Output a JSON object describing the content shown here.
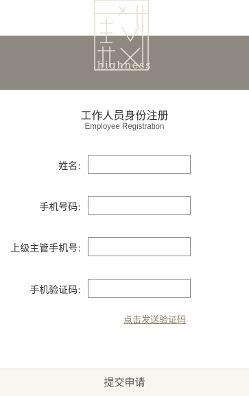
{
  "brand": {
    "logo_icon": "highness-logo",
    "name": "highness",
    "band_color": "#8d8880",
    "logo_color": "#e8dfd3"
  },
  "title": {
    "cn": "工作人员身份注册",
    "en": "Employee Registration"
  },
  "form": {
    "fields": [
      {
        "label": "姓名:",
        "value": ""
      },
      {
        "label": "手机号码:",
        "value": ""
      },
      {
        "label": "上级主管手机号:",
        "value": ""
      },
      {
        "label": "手机验证码:",
        "value": ""
      }
    ],
    "send_code_link": "点击发送验证码",
    "submit_label": "提交申请"
  }
}
